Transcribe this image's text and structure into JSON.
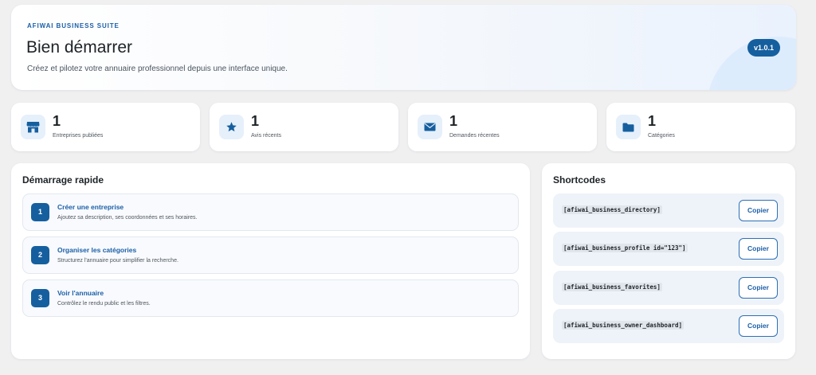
{
  "hero": {
    "eyebrow": "AFIWAI BUSINESS SUITE",
    "title": "Bien démarrer",
    "subtitle": "Créez et pilotez votre annuaire professionnel depuis une interface unique.",
    "version": "v1.0.1"
  },
  "stats": [
    {
      "value": "1",
      "label": "Entreprises publiées",
      "icon": "storefront-icon"
    },
    {
      "value": "1",
      "label": "Avis récents",
      "icon": "star-icon"
    },
    {
      "value": "1",
      "label": "Demandes récentes",
      "icon": "envelope-icon"
    },
    {
      "value": "1",
      "label": "Catégories",
      "icon": "folder-icon"
    }
  ],
  "quickstart": {
    "title": "Démarrage rapide",
    "steps": [
      {
        "num": "1",
        "title": "Créer une entreprise",
        "desc": "Ajoutez sa description, ses coordonnées et ses horaires."
      },
      {
        "num": "2",
        "title": "Organiser les catégories",
        "desc": "Structurez l'annuaire pour simplifier la recherche."
      },
      {
        "num": "3",
        "title": "Voir l'annuaire",
        "desc": "Contrôlez le rendu public et les filtres."
      }
    ]
  },
  "shortcodes": {
    "title": "Shortcodes",
    "copy_label": "Copier",
    "items": [
      "[afiwai_business_directory]",
      "[afiwai_business_profile id=\"123\"]",
      "[afiwai_business_favorites]",
      "[afiwai_business_owner_dashboard]"
    ]
  },
  "colors": {
    "accent": "#165f9f",
    "accent_text": "#1b5fa8",
    "background": "#f0f0f1"
  }
}
